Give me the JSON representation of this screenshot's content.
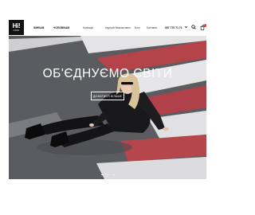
{
  "header": {
    "logo": {
      "mark": "Hi!",
      "sub": "LOOK"
    },
    "nav_main": [
      "ЖІНКАМ",
      "ЧОЛОВІКАМ"
    ],
    "nav_secondary": [
      "Колекція",
      "Круглий безкоштовно",
      "Блог",
      "Контакти"
    ],
    "phone": "097 770 71 71",
    "icons": [
      "chevron-down-icon",
      "search-icon",
      "cart-icon"
    ],
    "cart_count": "0"
  },
  "hero": {
    "title": "ОБ'ЄДНУЄМО СВІТИ",
    "button_label": "ДІЗНАТИСЯ БІЛЬШЕ",
    "slides": 3,
    "active_slide": 1
  },
  "colors": {
    "accent": "#d9302c",
    "asphalt": "#5e5f63",
    "crosswalk_white": "#e7e7e9",
    "crosswalk_red": "#b5434a"
  }
}
